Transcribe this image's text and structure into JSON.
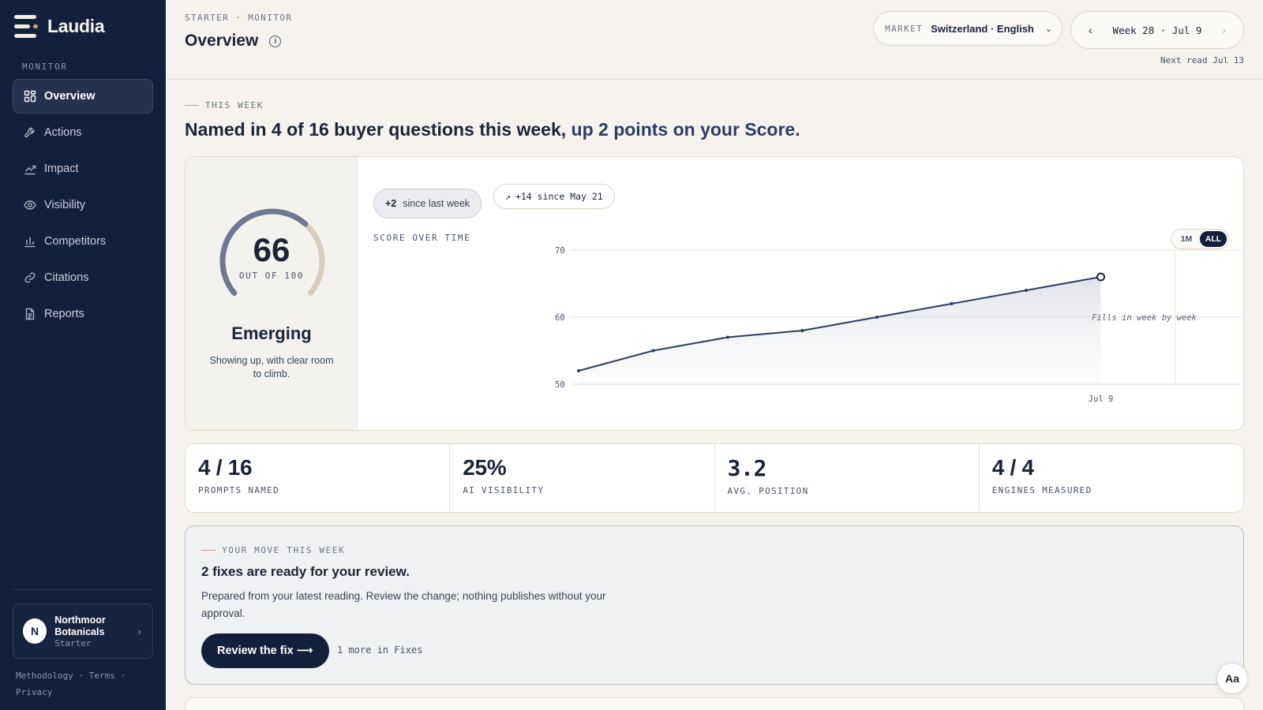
{
  "brand": {
    "name": "Laudia"
  },
  "sidebar": {
    "section_label": "MONITOR",
    "items": [
      {
        "label": "Overview",
        "icon": "grid-icon",
        "active": true
      },
      {
        "label": "Actions",
        "icon": "wrench-icon"
      },
      {
        "label": "Impact",
        "icon": "trend-icon"
      },
      {
        "label": "Visibility",
        "icon": "eye-icon"
      },
      {
        "label": "Competitors",
        "icon": "bar-chart-icon"
      },
      {
        "label": "Citations",
        "icon": "link-icon"
      },
      {
        "label": "Reports",
        "icon": "document-icon"
      }
    ],
    "account": {
      "initial": "N",
      "name": "Northmoor Botanicals",
      "plan": "Starter"
    },
    "footer": {
      "methodology": "Methodology",
      "terms": "Terms",
      "privacy": "Privacy"
    }
  },
  "header": {
    "breadcrumb": "STARTER · MONITOR",
    "title": "Overview",
    "market_label": "MARKET",
    "market_value": "Switzerland · English",
    "week_label": "Week 28 · Jul 9",
    "next_read": "Next read Jul 13"
  },
  "summary": {
    "eyebrow": "THIS WEEK",
    "headline_main": "Named in 4 of 16 buyer questions this week, ",
    "headline_highlight": "up 2 points on your Score."
  },
  "score": {
    "value": "66",
    "max_label": "OUT OF 100",
    "value_fraction": 0.66,
    "tier": "Emerging",
    "tier_description": "Showing up, with clear room to climb.",
    "delta_value": "+2",
    "delta_label": "since last week",
    "since_badge": "+14 since May 21"
  },
  "chart": {
    "label": "SCORE OVER TIME",
    "range_options": [
      "1M",
      "ALL"
    ],
    "range_selected": "ALL",
    "placeholder_note": "Fills in week by week"
  },
  "chart_data": {
    "type": "line",
    "title": "SCORE OVER TIME",
    "x": [
      "",
      "",
      "",
      "",
      "",
      "",
      "",
      "Jul 9"
    ],
    "series": [
      {
        "values": [
          52,
          55,
          57,
          58,
          60,
          62,
          64,
          66
        ]
      }
    ],
    "ylim": [
      50,
      70
    ],
    "yticks": [
      50,
      60,
      70
    ],
    "xticks": [
      "Jul 9"
    ],
    "future_periods": 4,
    "grid": true,
    "xlabel": "",
    "ylabel": ""
  },
  "kpis": [
    {
      "value": "4 / 16",
      "label": "PROMPTS NAMED"
    },
    {
      "value": "25%",
      "label": "AI VISIBILITY"
    },
    {
      "value": "3.2",
      "label": "AVG. POSITION"
    },
    {
      "value": "4 / 4",
      "label": "ENGINES MEASURED"
    }
  ],
  "move": {
    "eyebrow": "YOUR MOVE THIS WEEK",
    "title": "2 fixes are ready for your review.",
    "description": "Prepared from your latest reading. Review the change; nothing publishes without your approval.",
    "button_label": "Review the fix",
    "more_label": "1 more in Fixes"
  },
  "font_button_label": "Aa",
  "colors": {
    "sidebar_bg": "#13203b",
    "accent_gold": "#c9a36b",
    "line": "#2c3c63",
    "gauge_filled": "#6f7893",
    "gauge_empty": "#d6cdbd"
  }
}
